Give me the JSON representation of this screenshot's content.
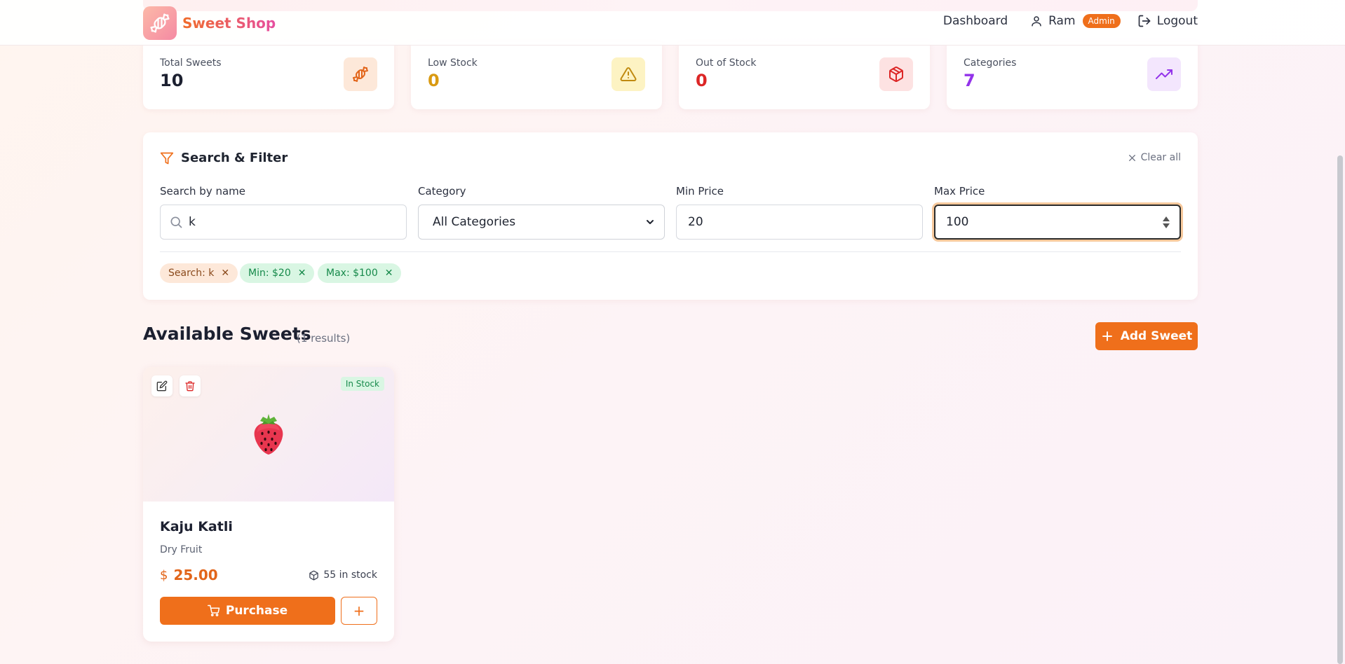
{
  "header": {
    "brand": "Sweet Shop",
    "nav": {
      "dashboard": "Dashboard",
      "user": "Ram",
      "role_badge": "Admin",
      "logout": "Logout"
    }
  },
  "stats": [
    {
      "label": "Total Sweets",
      "value": "10",
      "icon": "candy-icon",
      "color": "#1c2030",
      "icon_bg": "#fde8d9",
      "icon_color": "#e2651a"
    },
    {
      "label": "Low Stock",
      "value": "0",
      "icon": "warning-icon",
      "color": "#d99a12",
      "icon_bg": "#fdf3c3",
      "icon_color": "#c08a10"
    },
    {
      "label": "Out of Stock",
      "value": "0",
      "icon": "package-icon",
      "color": "#dc2626",
      "icon_bg": "#fde2e2",
      "icon_color": "#dc2626"
    },
    {
      "label": "Categories",
      "value": "7",
      "icon": "trending-up-icon",
      "color": "#9333ea",
      "icon_bg": "#f3e6fd",
      "icon_color": "#9333ea"
    }
  ],
  "filter": {
    "title": "Search & Filter",
    "clear_all": "Clear all",
    "search_label": "Search by name",
    "search_value": "k",
    "category_label": "Category",
    "category_value": "All Categories",
    "min_label": "Min Price",
    "min_value": "20",
    "max_label": "Max Price",
    "max_value": "100",
    "chips": [
      {
        "label": "Search: k",
        "bg": "#fde8d9",
        "color": "#8a4a1c"
      },
      {
        "label": "Min: $20",
        "bg": "#d9f6e3",
        "color": "#16894a"
      },
      {
        "label": "Max: $100",
        "bg": "#d9f6e3",
        "color": "#16894a"
      }
    ]
  },
  "section": {
    "title": "Available Sweets",
    "results": "(1 results)",
    "add_button": "Add Sweet"
  },
  "card": {
    "badge": "In Stock",
    "name": "Kaju Katli",
    "category": "Dry Fruit",
    "currency": "$",
    "price": "25.00",
    "stock": "55 in stock",
    "purchase": "Purchase",
    "plus": "+"
  },
  "colors": {
    "accent": "#ef6f1b"
  }
}
